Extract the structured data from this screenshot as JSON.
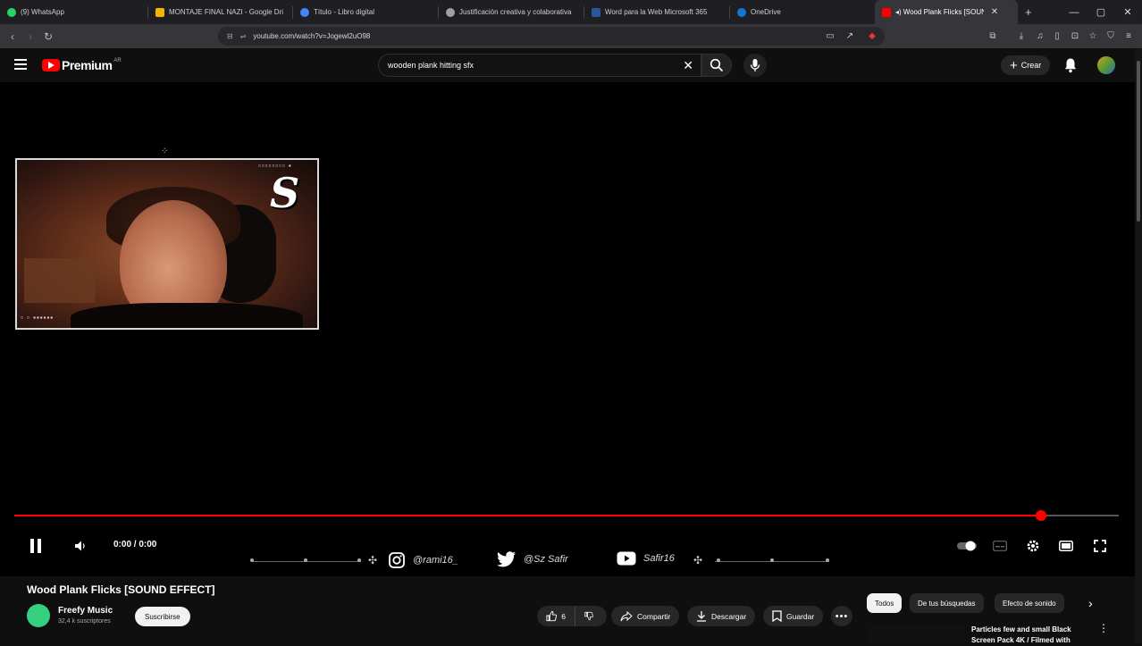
{
  "browser": {
    "tabs": [
      {
        "label": "(9) WhatsApp",
        "color": "#25d366"
      },
      {
        "label": "MONTAJE FINAL NAZI - Google Dri",
        "color": "#f4b400"
      },
      {
        "label": "Título - Libro digital",
        "color": "#4285f4"
      },
      {
        "label": "Justificación creativa y colaborativa",
        "color": "#9aa0a6"
      },
      {
        "label": "Word para la Web Microsoft 365",
        "color": "#2b579a"
      },
      {
        "label": "OneDrive",
        "color": "#0f78d4"
      },
      {
        "label": "Wood Plank Flicks [SOUND E",
        "color": "#ff0000"
      }
    ],
    "url": "youtube.com/watch?v=Jogewl2uO98"
  },
  "header": {
    "logo_text": "Premium",
    "logo_region": "AR",
    "search_value": "wooden plank hitting sfx",
    "create_label": "Crear"
  },
  "player": {
    "time": "0:00 / 0:00",
    "progress": 0.93,
    "overlay_logo": "S",
    "socials": [
      {
        "icon": "instagram-icon",
        "label": "@rami16_"
      },
      {
        "icon": "twitter-icon",
        "label": "@Sz Safir"
      },
      {
        "icon": "youtube-icon",
        "label": "Safir16"
      }
    ]
  },
  "video": {
    "title": "Wood Plank Flicks [SOUND EFFECT]",
    "channel": "Freefy Music",
    "subscribers": "32,4 k suscriptores",
    "subscribe_label": "Suscribirse",
    "likes": "6",
    "share_label": "Compartir",
    "download_label": "Descargar",
    "save_label": "Guardar"
  },
  "chips": [
    "Todos",
    "De tus búsquedas",
    "Efecto de sonido"
  ],
  "recommendation": {
    "title": "Particles few and small Black Screen Pack 4K / Filmed with"
  }
}
